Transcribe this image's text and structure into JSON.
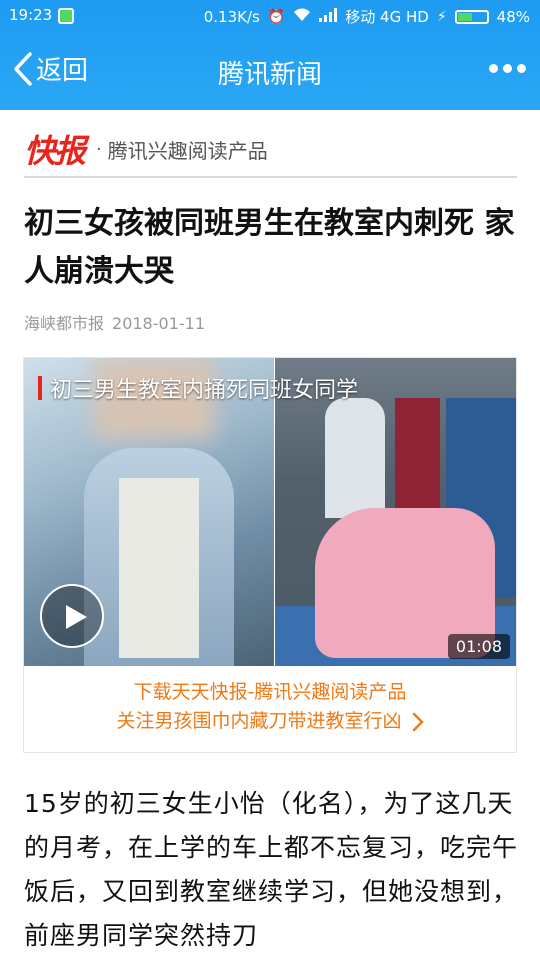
{
  "status_bar": {
    "time": "19:23",
    "speed": "0.13K/s",
    "carrier": "移动 4G HD",
    "battery": "48%"
  },
  "nav": {
    "back_label": "返回",
    "title": "腾讯新闻",
    "more_icon": "more-dots-icon"
  },
  "brand": {
    "logo": "快报",
    "separator": "·",
    "subtitle": "腾讯兴趣阅读产品"
  },
  "article": {
    "headline": "初三女孩被同班男生在教室内刺死 家人崩溃大哭",
    "source": "海峡都市报",
    "date": "2018-01-11"
  },
  "video": {
    "title": "初三男生教室内捅死同班女同学",
    "duration": "01:08",
    "promo_line1": "下载天天快报-腾讯兴趣阅读产品",
    "promo_line2": "关注男孩围巾内藏刀带进教室行凶"
  },
  "body": {
    "paragraph": "15岁的初三女生小怡（化名），为了这几天的月考，在上学的车上都不忘复习，吃完午饭后，又回到教室继续学习，但她没想到，前座男同学突然持刀"
  },
  "colors": {
    "header_blue": "#2aa7f4",
    "logo_red": "#e8241c",
    "promo_orange": "#f07a16"
  }
}
